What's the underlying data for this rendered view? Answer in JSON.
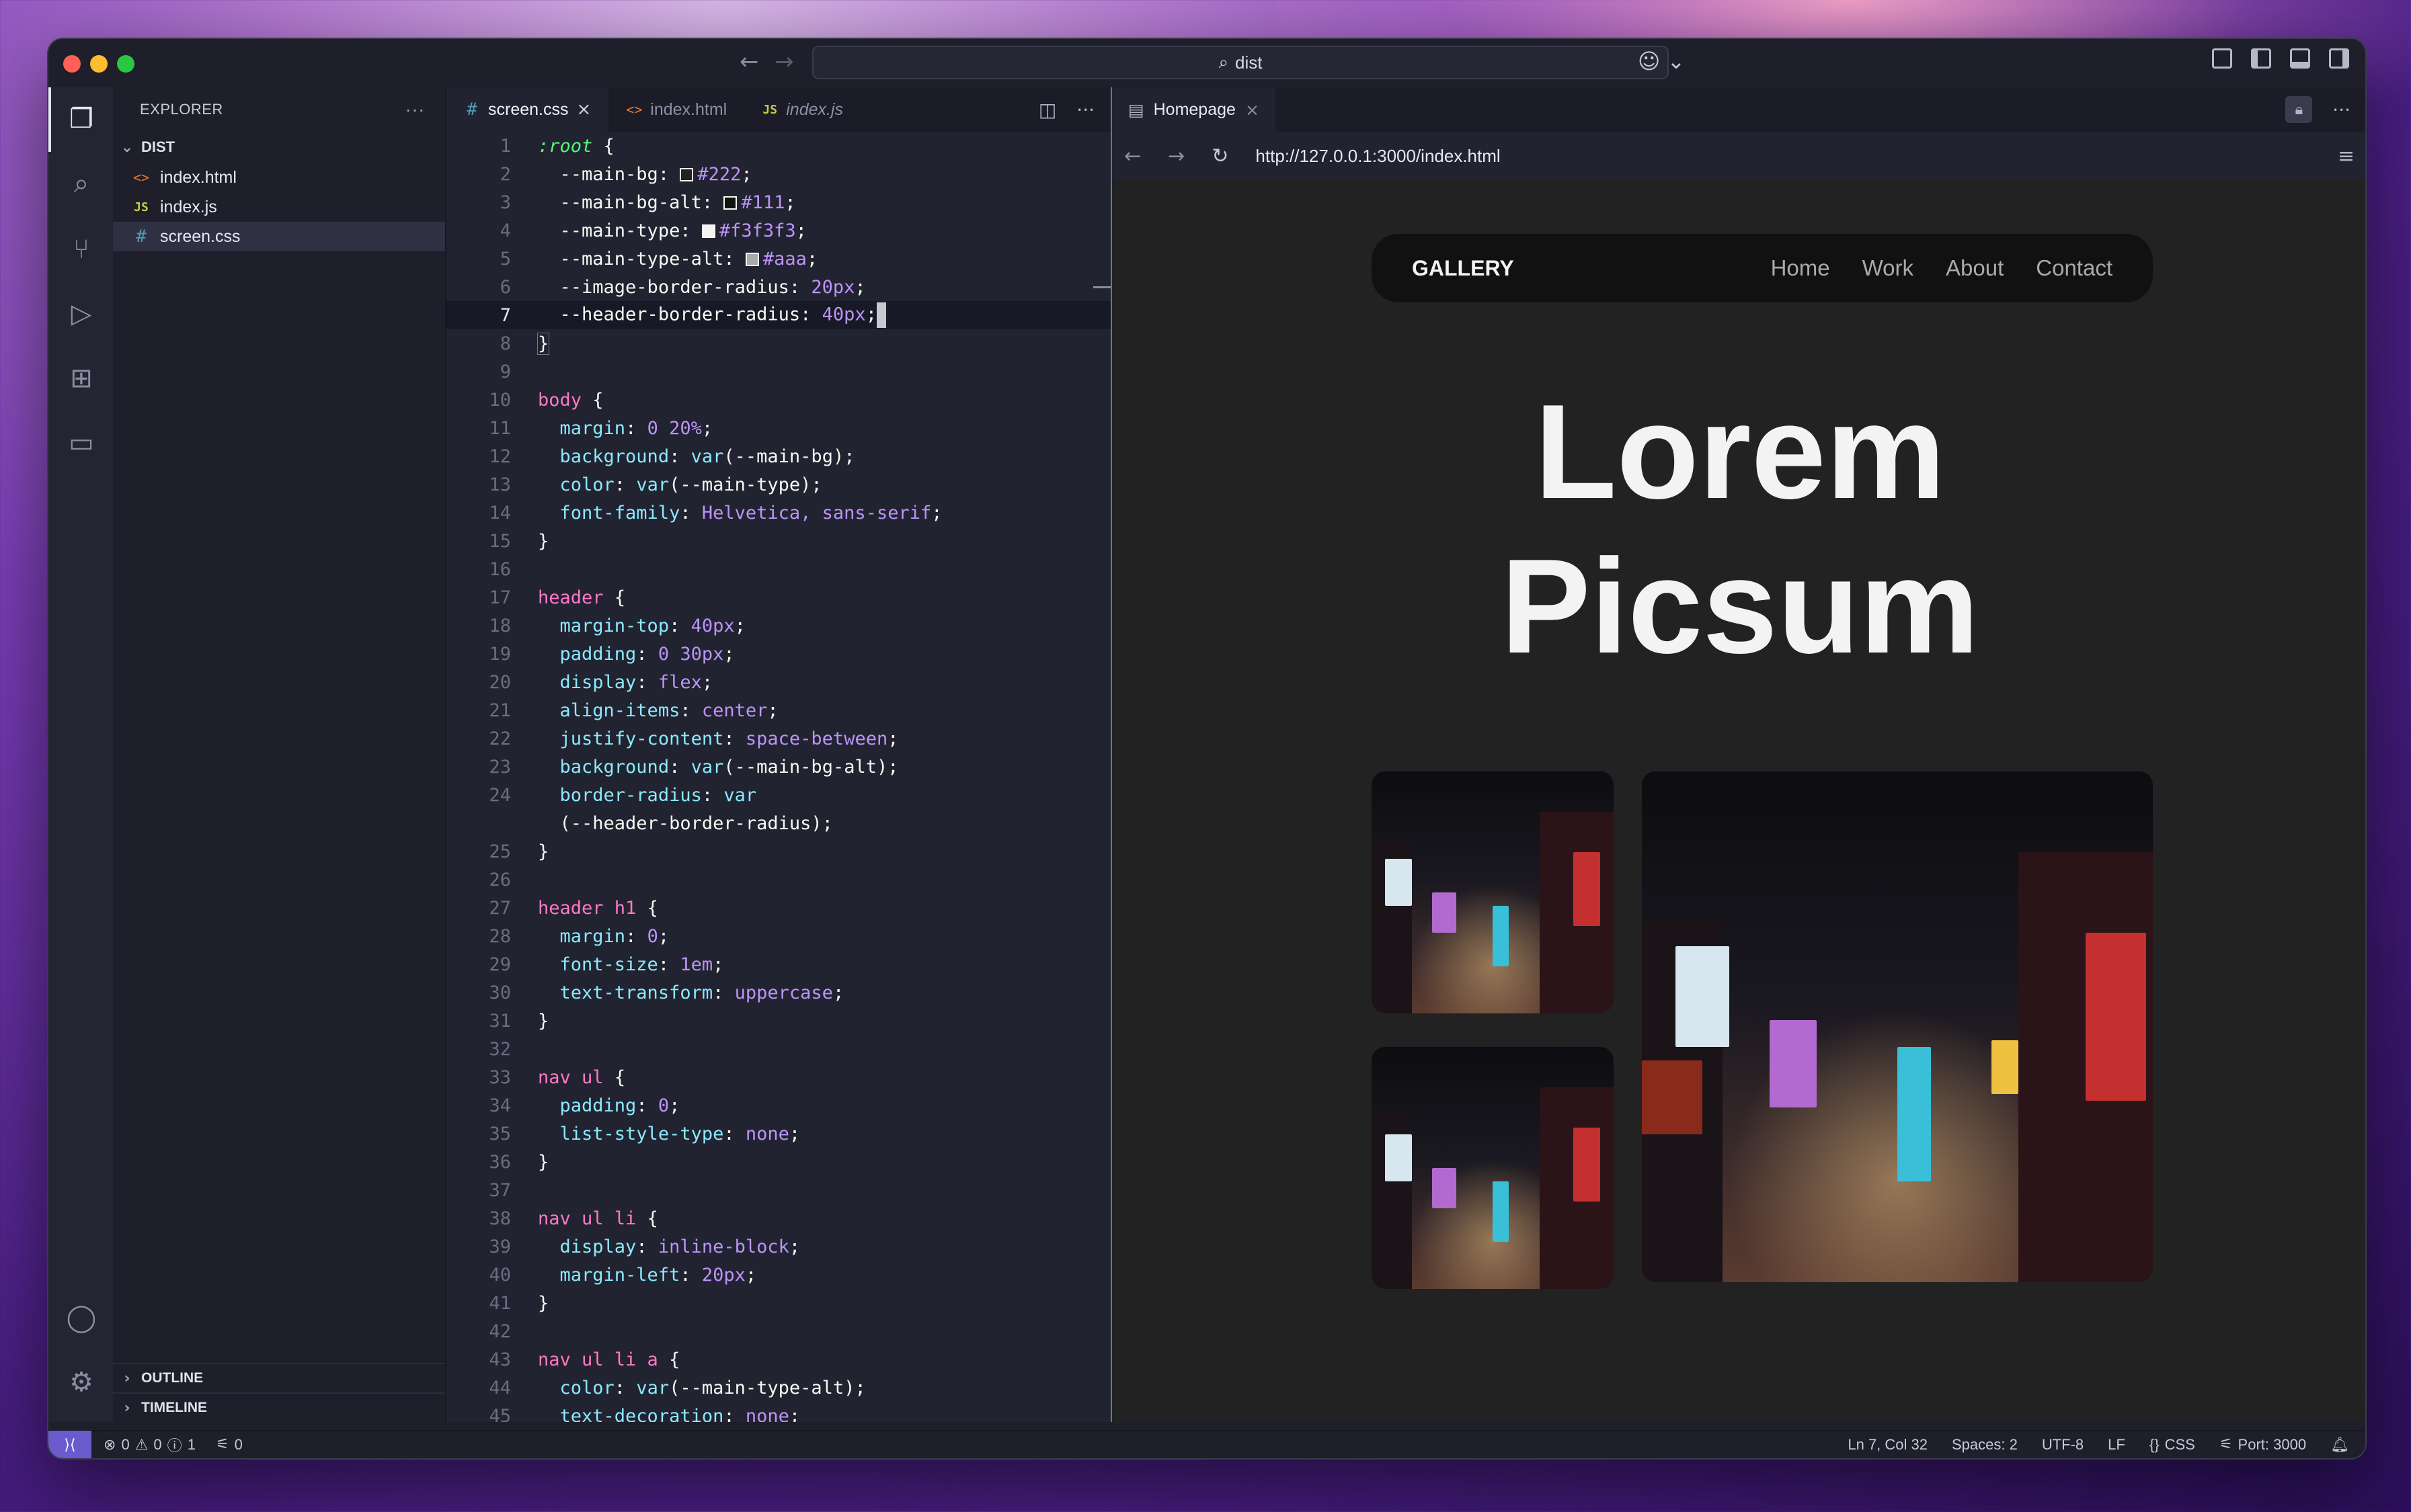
{
  "window": {
    "search_text": "dist"
  },
  "explorer": {
    "title": "EXPLORER",
    "folder": "DIST",
    "files": [
      "index.html",
      "index.js",
      "screen.css"
    ],
    "outline": "OUTLINE",
    "timeline": "TIMELINE"
  },
  "editor": {
    "tabs": [
      {
        "label": "screen.css",
        "icon": "#"
      },
      {
        "label": "index.html",
        "icon": "<>"
      },
      {
        "label": "index.js",
        "icon": "JS"
      }
    ],
    "lines": [
      {
        "n": "1"
      },
      {
        "n": "2"
      },
      {
        "n": "3"
      },
      {
        "n": "4"
      },
      {
        "n": "5"
      },
      {
        "n": "6"
      },
      {
        "n": "7"
      },
      {
        "n": "8"
      },
      {
        "n": "9"
      },
      {
        "n": "10"
      },
      {
        "n": "11"
      },
      {
        "n": "12"
      },
      {
        "n": "13"
      },
      {
        "n": "14"
      },
      {
        "n": "15"
      },
      {
        "n": "16"
      },
      {
        "n": "17"
      },
      {
        "n": "18"
      },
      {
        "n": "19"
      },
      {
        "n": "20"
      },
      {
        "n": "21"
      },
      {
        "n": "22"
      },
      {
        "n": "23"
      },
      {
        "n": "24"
      },
      {
        "n": ""
      },
      {
        "n": "25"
      },
      {
        "n": "26"
      },
      {
        "n": "27"
      },
      {
        "n": "28"
      },
      {
        "n": "29"
      },
      {
        "n": "30"
      },
      {
        "n": "31"
      },
      {
        "n": "32"
      },
      {
        "n": "33"
      },
      {
        "n": "34"
      },
      {
        "n": "35"
      },
      {
        "n": "36"
      },
      {
        "n": "37"
      },
      {
        "n": "38"
      },
      {
        "n": "39"
      },
      {
        "n": "40"
      },
      {
        "n": "41"
      },
      {
        "n": "42"
      },
      {
        "n": "43"
      },
      {
        "n": "44"
      },
      {
        "n": "45"
      }
    ],
    "current_line": "7"
  },
  "preview": {
    "tab_label": "Homepage",
    "url": "http://127.0.0.1:3000/index.html",
    "site": {
      "logo": "GALLERY",
      "nav": [
        "Home",
        "Work",
        "About",
        "Contact"
      ],
      "hero_line1": "Lorem",
      "hero_line2": "Picsum"
    }
  },
  "statusbar": {
    "errors": "0",
    "warnings": "0",
    "infos": "1",
    "ports_count": "0",
    "position": "Ln 7, Col 32",
    "spaces": "Spaces: 2",
    "encoding": "UTF-8",
    "eol": "LF",
    "language": "CSS",
    "port": "Port: 3000"
  },
  "colors": {
    "status_bar": "#1e1f2b",
    "remote_badge": "#6b5acd",
    "site_bg": "#222222",
    "site_header_bg": "#111111"
  }
}
